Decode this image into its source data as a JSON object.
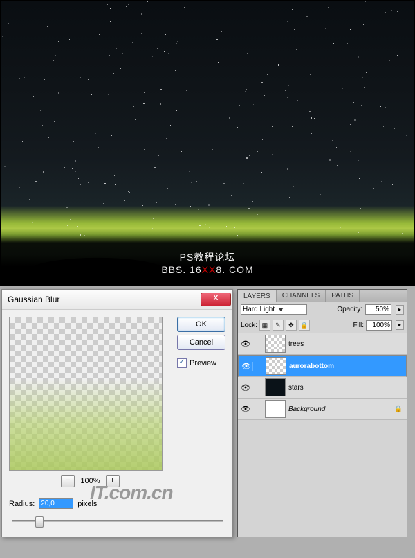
{
  "watermark": {
    "line1": "PS教程论坛",
    "line2_pre": "BBS. 16",
    "line2_red": "XX",
    "line2_post": "8. COM"
  },
  "watermark2": "IT.com.cn",
  "dialog": {
    "title": "Gaussian Blur",
    "ok": "OK",
    "cancel": "Cancel",
    "preview": "Preview",
    "zoom": "100%",
    "minus": "−",
    "plus": "+",
    "radius_label": "Radius:",
    "radius_value": "20,0",
    "radius_unit": "pixels"
  },
  "panel": {
    "tabs": [
      "LAYERS",
      "CHANNELS",
      "PATHS"
    ],
    "blend_mode": "Hard Light",
    "opacity_label": "Opacity:",
    "opacity_value": "50%",
    "lock_label": "Lock:",
    "fill_label": "Fill:",
    "fill_value": "100%",
    "layers": [
      {
        "name": "trees",
        "thumb": "checker"
      },
      {
        "name": "aurorabottom",
        "thumb": "checker",
        "selected": true,
        "bold": true
      },
      {
        "name": "stars",
        "thumb": "stars"
      },
      {
        "name": "Background",
        "thumb": "white",
        "italic": true,
        "locked": true
      }
    ]
  }
}
